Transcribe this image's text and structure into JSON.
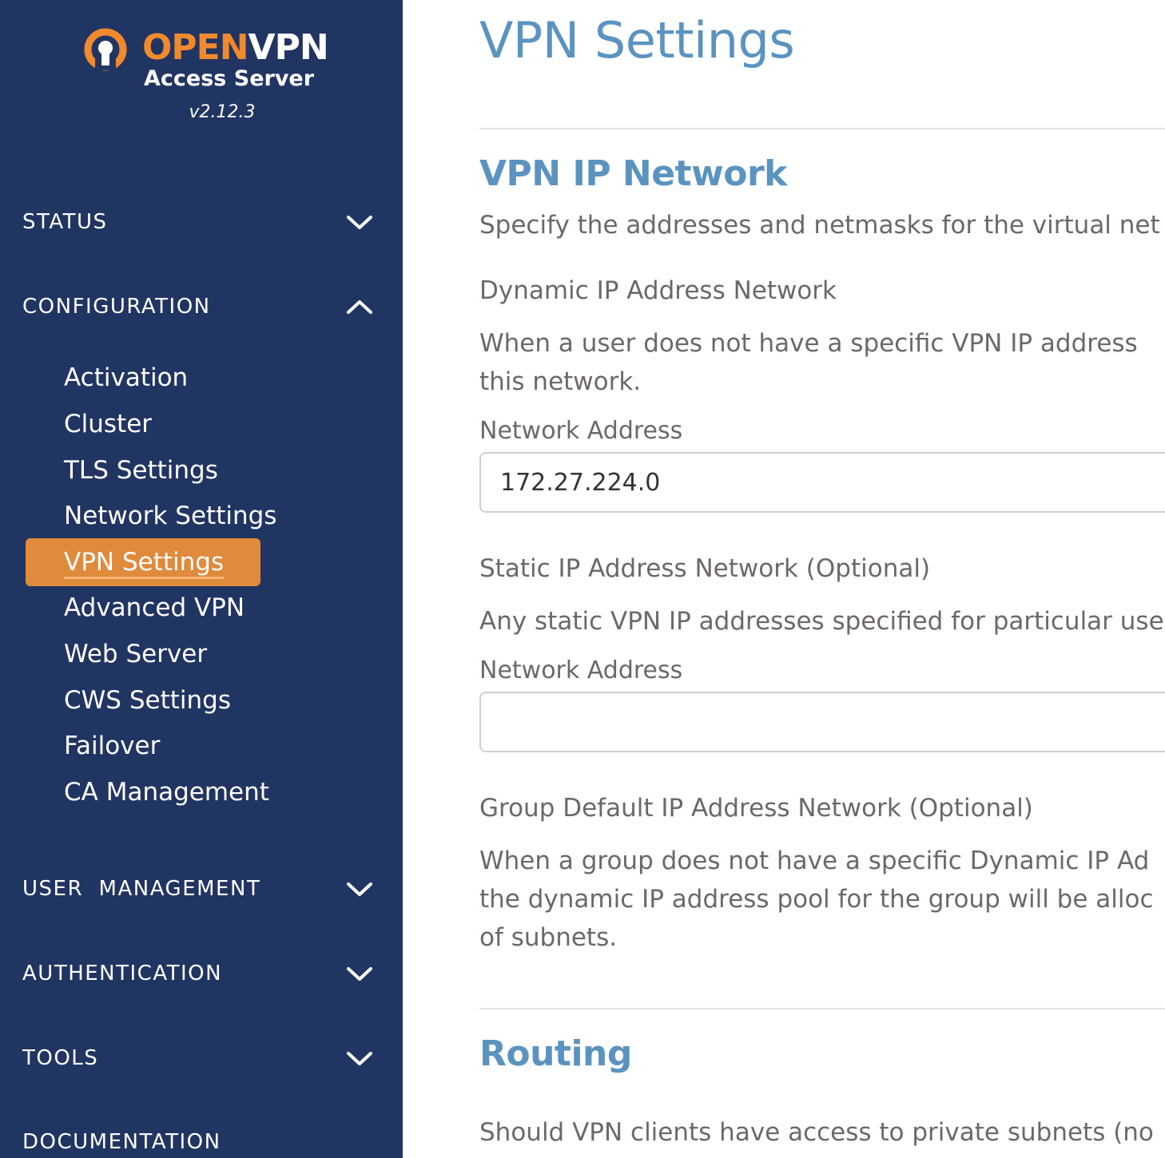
{
  "app": {
    "logo_word_1": "OPEN",
    "logo_word_2": "VPN",
    "logo_sub": "Access Server",
    "version": "v2.12.3",
    "accent_color": "#e08a3c",
    "sidebar_color": "#213563"
  },
  "sidebar": {
    "sections": [
      {
        "label": "STATUS",
        "icon": "chevron-down-icon"
      },
      {
        "label": "CONFIGURATION",
        "icon": "chevron-up-icon"
      },
      {
        "label": "USER  MANAGEMENT",
        "icon": "chevron-down-icon"
      },
      {
        "label": "AUTHENTICATION",
        "icon": "chevron-down-icon"
      },
      {
        "label": "TOOLS",
        "icon": "chevron-down-icon"
      },
      {
        "label": "DOCUMENTATION"
      }
    ],
    "config_items": [
      "Activation",
      "Cluster",
      "TLS Settings",
      "Network Settings",
      "VPN Settings",
      "Advanced VPN",
      "Web Server",
      "CWS Settings",
      "Failover",
      "CA Management"
    ],
    "active_item": "VPN Settings"
  },
  "main": {
    "title": "VPN Settings",
    "vpn_ip_network": {
      "title": "VPN IP Network",
      "description": "Specify the addresses and netmasks for the virtual net",
      "dynamic": {
        "title": "Dynamic IP Address Network",
        "description_line1": "When a user does not have a specific VPN IP address",
        "description_line2": "this network.",
        "field_label": "Network Address",
        "field_value": "172.27.224.0"
      },
      "static": {
        "title": "Static IP Address Network (Optional)",
        "description": "Any static VPN IP addresses specified for particular use",
        "field_label": "Network Address",
        "field_value": ""
      },
      "group_default": {
        "title": "Group Default IP Address Network (Optional)",
        "description_line1": "When a group does not have a specific Dynamic IP Ad",
        "description_line2": "the dynamic IP address pool for the group will be alloc",
        "description_line3": "of subnets."
      }
    },
    "routing": {
      "title": "Routing",
      "description": "Should VPN clients have access to private subnets (no"
    }
  }
}
